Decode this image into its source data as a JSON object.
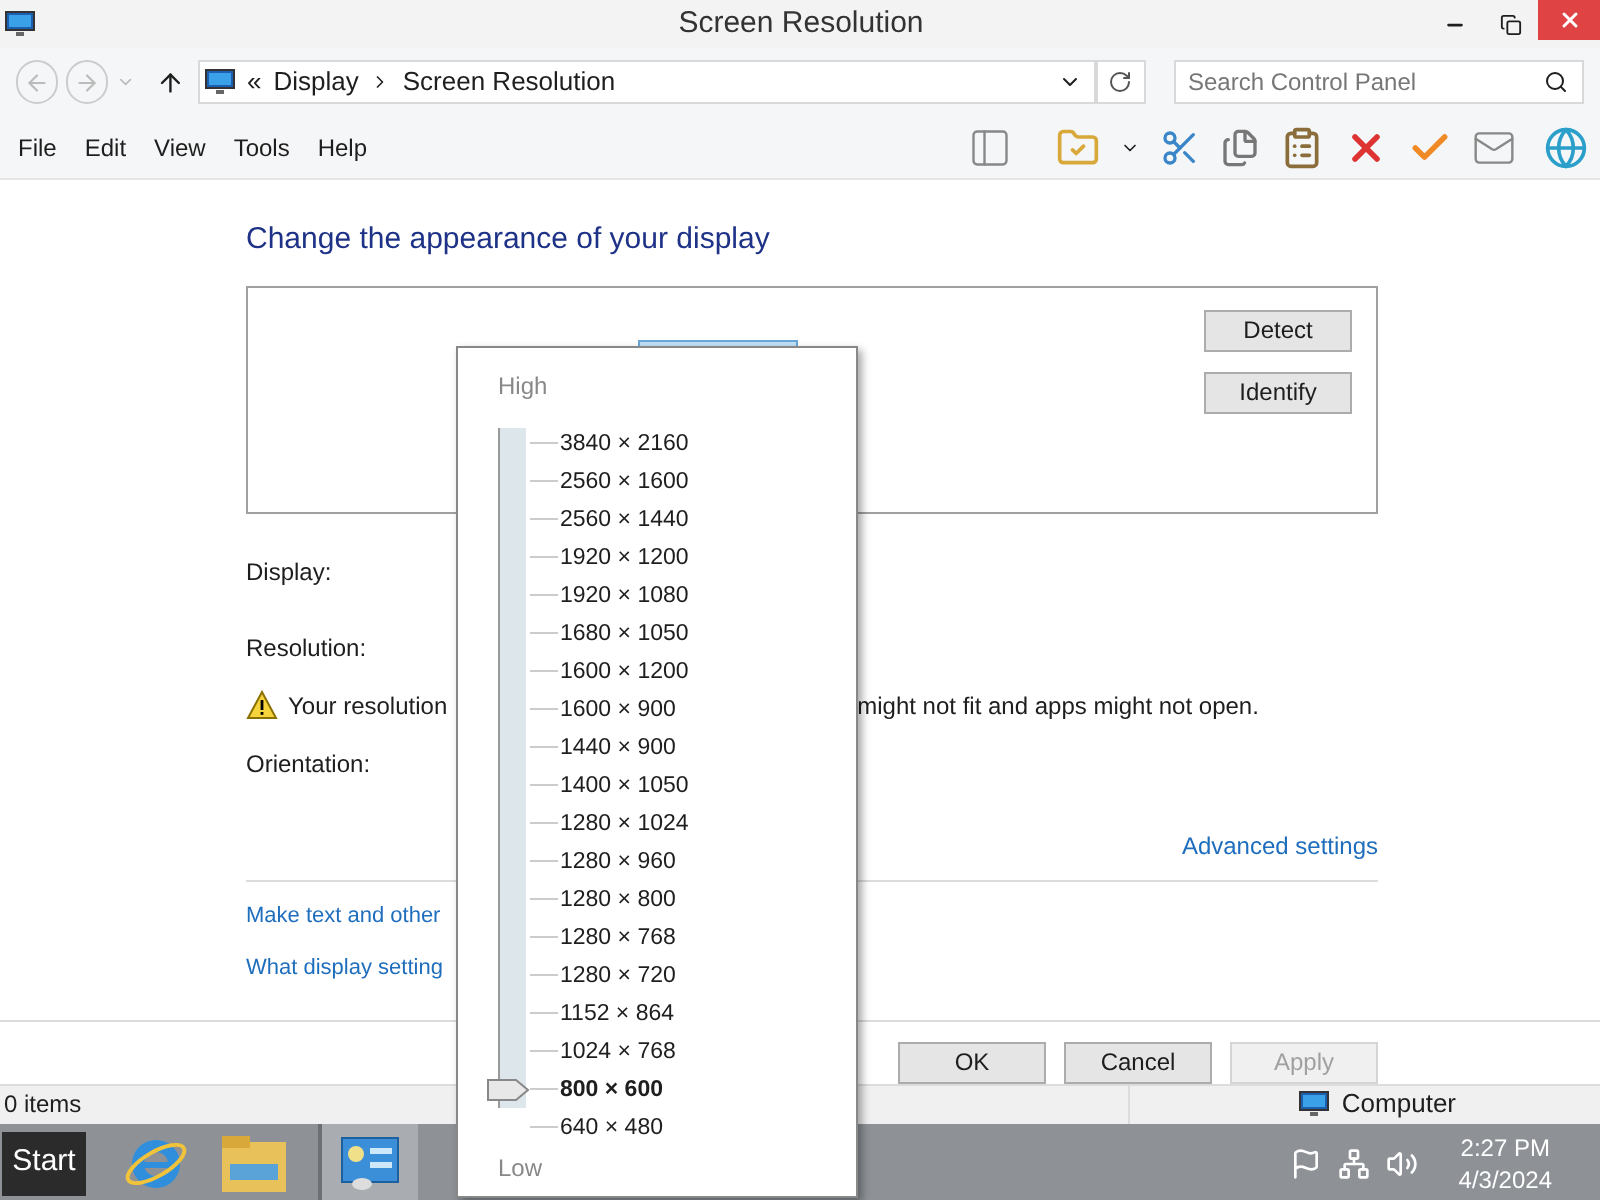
{
  "window": {
    "title": "Screen Resolution"
  },
  "address": {
    "prefix": "«",
    "crumbs": [
      "Display",
      "Screen Resolution"
    ]
  },
  "search": {
    "placeholder": "Search Control Panel"
  },
  "menu": [
    "File",
    "Edit",
    "View",
    "Tools",
    "Help"
  ],
  "heading": "Change the appearance of your display",
  "preview_buttons": [
    "Detect",
    "Identify"
  ],
  "fields": [
    "Display:",
    "Resolution:"
  ],
  "warning": {
    "before": "Your resolution",
    "after": "might not fit and apps might not open."
  },
  "orientation_label": "Orientation:",
  "advanced_link": "Advanced settings",
  "links": [
    "Make text and other",
    "What display setting"
  ],
  "buttons": [
    {
      "label": "OK",
      "disabled": false
    },
    {
      "label": "Cancel",
      "disabled": false
    },
    {
      "label": "Apply",
      "disabled": true
    }
  ],
  "status_bar": {
    "items": "0 items",
    "location": "Computer"
  },
  "taskbar": {
    "start": "Start",
    "time": "2:27 PM",
    "date": "4/3/2024"
  },
  "resolution_popup": {
    "high": "High",
    "low": "Low",
    "options": [
      {
        "label": "3840 × 2160",
        "selected": false
      },
      {
        "label": "2560 × 1600",
        "selected": false
      },
      {
        "label": "2560 × 1440",
        "selected": false
      },
      {
        "label": "1920 × 1200",
        "selected": false
      },
      {
        "label": "1920 × 1080",
        "selected": false
      },
      {
        "label": "1680 × 1050",
        "selected": false
      },
      {
        "label": "1600 × 1200",
        "selected": false
      },
      {
        "label": "1600 × 900",
        "selected": false
      },
      {
        "label": "1440 × 900",
        "selected": false
      },
      {
        "label": "1400 × 1050",
        "selected": false
      },
      {
        "label": "1280 × 1024",
        "selected": false
      },
      {
        "label": "1280 × 960",
        "selected": false
      },
      {
        "label": "1280 × 800",
        "selected": false
      },
      {
        "label": "1280 × 768",
        "selected": false
      },
      {
        "label": "1280 × 720",
        "selected": false
      },
      {
        "label": "1152 × 864",
        "selected": false
      },
      {
        "label": "1024 × 768",
        "selected": false
      },
      {
        "label": "800 × 600",
        "selected": true
      },
      {
        "label": "640 × 480",
        "selected": false
      }
    ]
  }
}
